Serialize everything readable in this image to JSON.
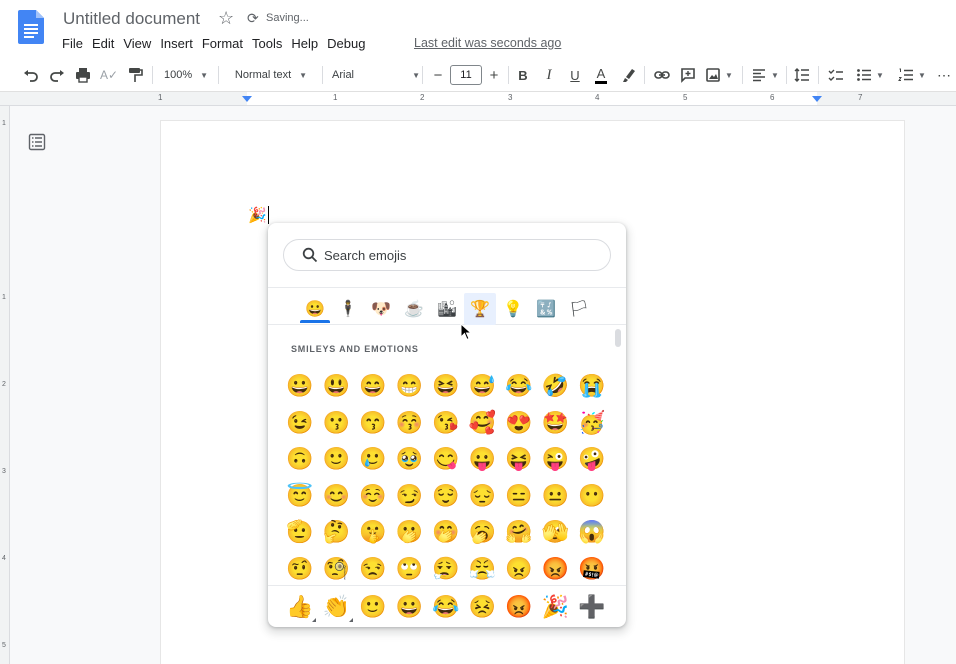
{
  "titlebar": {
    "doc_title": "Untitled document",
    "status": "Saving...",
    "menu": [
      "File",
      "Edit",
      "View",
      "Insert",
      "Format",
      "Tools",
      "Help",
      "Debug"
    ],
    "last_edit": "Last edit was seconds ago"
  },
  "toolbar": {
    "zoom": "100%",
    "style": "Normal text",
    "font": "Arial",
    "font_size": "11",
    "minus": "−",
    "plus": "+",
    "bold": "B",
    "italic": "I",
    "underline": "U",
    "text_color_letter": "A",
    "overflow": "⋯"
  },
  "ruler": {
    "numbers": [
      "1",
      "1",
      "2",
      "3",
      "4",
      "5",
      "6",
      "7"
    ]
  },
  "vruler": {
    "numbers": [
      "1",
      "1",
      "2",
      "3",
      "4",
      "5"
    ]
  },
  "document": {
    "inserted_emoji": "🎉"
  },
  "emoji_picker": {
    "search_placeholder": "Search emojis",
    "categories": [
      "😀",
      "🕴",
      "🐶",
      "☕",
      "🏙",
      "🏆",
      "💡",
      "🔣",
      "🏳"
    ],
    "section_title": "SMILEYS AND EMOTIONS",
    "emojis": [
      "😀",
      "😃",
      "😄",
      "😁",
      "😆",
      "😅",
      "😂",
      "🤣",
      "😭",
      "😉",
      "😗",
      "😙",
      "😚",
      "😘",
      "🥰",
      "😍",
      "🤩",
      "🥳",
      "🙃",
      "🙂",
      "🥲",
      "🥹",
      "😋",
      "😛",
      "😝",
      "😜",
      "🤪",
      "😇",
      "😊",
      "☺️",
      "😏",
      "😌",
      "😔",
      "😑",
      "😐",
      "😶",
      "🫡",
      "🤔",
      "🤫",
      "🫢",
      "🤭",
      "🥱",
      "🤗",
      "🫣",
      "😱",
      "🤨",
      "🧐",
      "😒",
      "🙄",
      "😮‍💨",
      "😤",
      "😠",
      "😡",
      "🤬"
    ],
    "recent": [
      "👍",
      "👏",
      "🙂",
      "😀",
      "😂",
      "😣",
      "😡",
      "🎉",
      "➕"
    ],
    "colors": {
      "accent": "#1a73e8",
      "hover_bg": "#e8f0fe"
    }
  }
}
